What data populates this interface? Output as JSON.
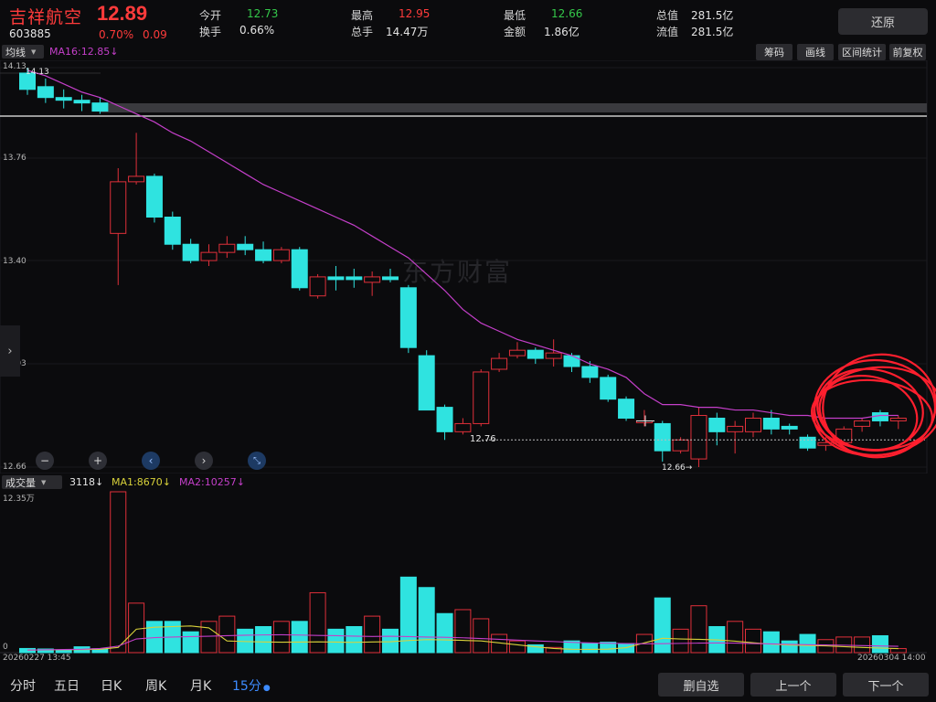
{
  "header": {
    "name": "吉祥航空",
    "price": "12.89",
    "code": "603885",
    "change_pct": "0.70%",
    "change": "0.09",
    "quote_fields": [
      {
        "label": "今开",
        "value": "12.73",
        "color": "green"
      },
      {
        "label": "换手",
        "value": "0.66%",
        "color": "white"
      },
      {
        "label": "最高",
        "value": "12.95",
        "color": "red"
      },
      {
        "label": "总手",
        "value": "14.47万",
        "color": "white"
      },
      {
        "label": "最低",
        "value": "12.66",
        "color": "green"
      },
      {
        "label": "金额",
        "value": "1.86亿",
        "color": "white"
      },
      {
        "label": "总值",
        "value": "281.5亿",
        "color": "white"
      },
      {
        "label": "流值",
        "value": "281.5亿",
        "color": "white"
      }
    ],
    "restore_label": "还原"
  },
  "toolbar": {
    "indicator": "均线",
    "ma_label": "MA16:12.85",
    "ma_arrow": "↓",
    "tools": [
      "筹码",
      "画线",
      "区间统计",
      "前复权"
    ]
  },
  "price_axis": {
    "labels": [
      "14.13",
      "13.76",
      "13.40",
      "13.03",
      "12.66"
    ],
    "high_marker": "14.13",
    "low_marker_left": "12.76",
    "low_marker_right": "12.66→"
  },
  "watermark": "东方财富",
  "volume_bar": {
    "indicator": "成交量",
    "current": "3118",
    "current_arrow": "↓",
    "ma1_label": "MA1:8670",
    "ma1_arrow": "↓",
    "ma2_label": "MA2:10257",
    "ma2_arrow": "↓",
    "axis_top": "12.35万",
    "axis_bottom": "0"
  },
  "time_axis": {
    "start": "20260227 13:45",
    "end": "20260304 14:00"
  },
  "periods": [
    "分时",
    "五日",
    "日K",
    "周K",
    "月K",
    "15分"
  ],
  "active_period": "15分",
  "bottom_buttons": [
    "删自选",
    "上一个",
    "下一个"
  ],
  "colors": {
    "up": "#e0303a",
    "down": "#2fe3e0",
    "ma16": "#c43fc9",
    "vol_ma1": "#d8d13a",
    "vol_ma2": "#c43fc9",
    "annotation": "#ff1f2e",
    "active_tab": "#3d8bff"
  },
  "chart_data": {
    "type": "candlestick",
    "price_range": [
      12.66,
      14.13
    ],
    "volume_range": [
      0,
      123500
    ],
    "ma16_price": [
      14.12,
      14.1,
      14.07,
      14.04,
      14.02,
      13.99,
      13.96,
      13.93,
      13.89,
      13.86,
      13.82,
      13.78,
      13.74,
      13.7,
      13.67,
      13.64,
      13.61,
      13.58,
      13.55,
      13.51,
      13.47,
      13.43,
      13.37,
      13.31,
      13.24,
      13.19,
      13.16,
      13.13,
      13.11,
      13.09,
      13.07,
      13.04,
      13.02,
      12.99,
      12.93,
      12.89,
      12.89,
      12.88,
      12.88,
      12.87,
      12.87,
      12.86,
      12.85,
      12.85,
      12.84,
      12.84,
      12.84,
      12.85,
      12.85
    ],
    "volume_ma1": [
      2000,
      2100,
      2200,
      2300,
      2600,
      4000,
      18000,
      19500,
      20000,
      20500,
      19000,
      9000,
      8500,
      8200,
      8000,
      8100,
      8300,
      8100,
      7900,
      8200,
      8400,
      9300,
      10000,
      9800,
      9400,
      9000,
      7500,
      6000,
      4500,
      3200,
      2600,
      2500,
      2700,
      3800,
      7500,
      11000,
      10500,
      10200,
      9800,
      8800,
      7600,
      6500,
      5800,
      5500,
      5200,
      4600,
      4000,
      3500,
      3100
    ],
    "volume_ma2": [
      2000,
      2200,
      2400,
      2600,
      3200,
      5000,
      10500,
      11500,
      12000,
      12300,
      12600,
      13000,
      13400,
      13600,
      13700,
      13500,
      13200,
      13000,
      12700,
      12400,
      12600,
      12300,
      12000,
      11800,
      11400,
      10800,
      10200,
      9600,
      9000,
      8500,
      7900,
      7500,
      7200,
      7000,
      6800,
      6900,
      7100,
      7300,
      7400,
      7300,
      7000,
      6700,
      6400,
      6100,
      5900,
      5700,
      5400,
      5100,
      4900
    ],
    "candles": [
      {
        "o": 14.11,
        "c": 14.05,
        "h": 14.13,
        "l": 14.03,
        "v": 3200
      },
      {
        "o": 14.06,
        "c": 14.02,
        "h": 14.09,
        "l": 14.0,
        "v": 2800
      },
      {
        "o": 14.02,
        "c": 14.01,
        "h": 14.05,
        "l": 13.98,
        "v": 1800
      },
      {
        "o": 14.01,
        "c": 14.0,
        "h": 14.03,
        "l": 13.97,
        "v": 4500
      },
      {
        "o": 14.0,
        "c": 13.97,
        "h": 14.02,
        "l": 13.96,
        "v": 3000
      },
      {
        "o": 13.52,
        "c": 13.71,
        "h": 13.76,
        "l": 13.33,
        "v": 123500
      },
      {
        "o": 13.71,
        "c": 13.73,
        "h": 13.89,
        "l": 13.7,
        "v": 38000
      },
      {
        "o": 13.73,
        "c": 13.58,
        "h": 13.74,
        "l": 13.56,
        "v": 24000
      },
      {
        "o": 13.58,
        "c": 13.48,
        "h": 13.6,
        "l": 13.46,
        "v": 24000
      },
      {
        "o": 13.48,
        "c": 13.42,
        "h": 13.5,
        "l": 13.41,
        "v": 16000
      },
      {
        "o": 13.42,
        "c": 13.45,
        "h": 13.48,
        "l": 13.4,
        "v": 24000
      },
      {
        "o": 13.45,
        "c": 13.48,
        "h": 13.51,
        "l": 13.43,
        "v": 28000
      },
      {
        "o": 13.48,
        "c": 13.46,
        "h": 13.51,
        "l": 13.44,
        "v": 18000
      },
      {
        "o": 13.46,
        "c": 13.42,
        "h": 13.49,
        "l": 13.41,
        "v": 20000
      },
      {
        "o": 13.42,
        "c": 13.46,
        "h": 13.47,
        "l": 13.41,
        "v": 24000
      },
      {
        "o": 13.46,
        "c": 13.32,
        "h": 13.47,
        "l": 13.31,
        "v": 24000
      },
      {
        "o": 13.29,
        "c": 13.36,
        "h": 13.37,
        "l": 13.28,
        "v": 46000
      },
      {
        "o": 13.36,
        "c": 13.35,
        "h": 13.4,
        "l": 13.31,
        "v": 18000
      },
      {
        "o": 13.36,
        "c": 13.35,
        "h": 13.39,
        "l": 13.32,
        "v": 20000
      },
      {
        "o": 13.34,
        "c": 13.36,
        "h": 13.38,
        "l": 13.29,
        "v": 28000
      },
      {
        "o": 13.36,
        "c": 13.35,
        "h": 13.39,
        "l": 13.34,
        "v": 18000
      },
      {
        "o": 13.32,
        "c": 13.1,
        "h": 13.33,
        "l": 13.08,
        "v": 58000
      },
      {
        "o": 13.07,
        "c": 12.87,
        "h": 13.09,
        "l": 12.87,
        "v": 50000
      },
      {
        "o": 12.88,
        "c": 12.79,
        "h": 12.89,
        "l": 12.76,
        "v": 30000
      },
      {
        "o": 12.79,
        "c": 12.82,
        "h": 12.84,
        "l": 12.78,
        "v": 33000
      },
      {
        "o": 12.82,
        "c": 13.01,
        "h": 13.02,
        "l": 12.81,
        "v": 26000
      },
      {
        "o": 13.02,
        "c": 13.06,
        "h": 13.08,
        "l": 13.01,
        "v": 14000
      },
      {
        "o": 13.07,
        "c": 13.09,
        "h": 13.12,
        "l": 13.06,
        "v": 9000
      },
      {
        "o": 13.09,
        "c": 13.06,
        "h": 13.1,
        "l": 13.04,
        "v": 6000
      },
      {
        "o": 13.06,
        "c": 13.08,
        "h": 13.13,
        "l": 13.03,
        "v": 4000
      },
      {
        "o": 13.07,
        "c": 13.03,
        "h": 13.08,
        "l": 13.01,
        "v": 9000
      },
      {
        "o": 13.03,
        "c": 12.99,
        "h": 13.05,
        "l": 12.97,
        "v": 7000
      },
      {
        "o": 12.99,
        "c": 12.91,
        "h": 13.0,
        "l": 12.9,
        "v": 8000
      },
      {
        "o": 12.91,
        "c": 12.84,
        "h": 12.92,
        "l": 12.83,
        "v": 7000
      },
      {
        "o": 12.83,
        "c": 12.83,
        "h": 12.87,
        "l": 12.81,
        "v": 14000
      },
      {
        "o": 12.82,
        "c": 12.72,
        "h": 12.83,
        "l": 12.68,
        "v": 42000
      },
      {
        "o": 12.72,
        "c": 12.76,
        "h": 12.77,
        "l": 12.71,
        "v": 18000
      },
      {
        "o": 12.69,
        "c": 12.85,
        "h": 12.88,
        "l": 12.66,
        "v": 36000
      },
      {
        "o": 12.84,
        "c": 12.79,
        "h": 12.86,
        "l": 12.74,
        "v": 20000
      },
      {
        "o": 12.79,
        "c": 12.81,
        "h": 12.83,
        "l": 12.71,
        "v": 24000
      },
      {
        "o": 12.79,
        "c": 12.84,
        "h": 12.86,
        "l": 12.77,
        "v": 18000
      },
      {
        "o": 12.84,
        "c": 12.8,
        "h": 12.87,
        "l": 12.78,
        "v": 16000
      },
      {
        "o": 12.81,
        "c": 12.8,
        "h": 12.82,
        "l": 12.78,
        "v": 9000
      },
      {
        "o": 12.77,
        "c": 12.73,
        "h": 12.78,
        "l": 12.72,
        "v": 14000
      },
      {
        "o": 12.74,
        "c": 12.75,
        "h": 12.77,
        "l": 12.72,
        "v": 10000
      },
      {
        "o": 12.75,
        "c": 12.8,
        "h": 12.81,
        "l": 12.74,
        "v": 12000
      },
      {
        "o": 12.81,
        "c": 12.83,
        "h": 12.84,
        "l": 12.79,
        "v": 12000
      },
      {
        "o": 12.86,
        "c": 12.83,
        "h": 12.87,
        "l": 12.81,
        "v": 13000
      },
      {
        "o": 12.83,
        "c": 12.84,
        "h": 12.85,
        "l": 12.8,
        "v": 3118
      }
    ]
  }
}
